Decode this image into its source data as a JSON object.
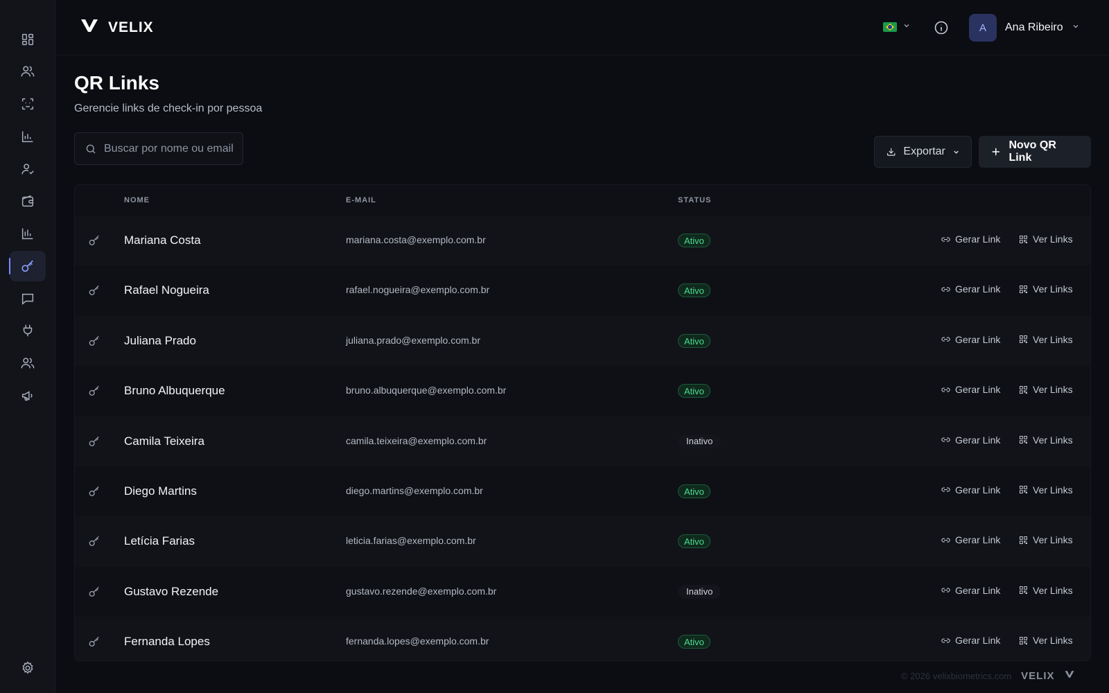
{
  "brand": {
    "name": "VELIX"
  },
  "topbar": {
    "language": "pt-BR",
    "user": {
      "initial": "A",
      "name": "Ana Ribeiro"
    }
  },
  "sidebar": {
    "items": [
      {
        "icon": "dashboard-icon"
      },
      {
        "icon": "users-icon"
      },
      {
        "icon": "face-scan-icon"
      },
      {
        "icon": "bar-chart-icon"
      },
      {
        "icon": "user-check-icon"
      },
      {
        "icon": "wallet-icon"
      },
      {
        "icon": "reports-chart-icon"
      },
      {
        "icon": "key-icon",
        "active": true
      },
      {
        "icon": "message-icon"
      },
      {
        "icon": "plug-icon"
      },
      {
        "icon": "team-icon"
      },
      {
        "icon": "megaphone-icon"
      }
    ],
    "settings_icon": "gear-icon"
  },
  "page": {
    "title": "QR Links",
    "subtitle": "Gerencie links de check-in por pessoa"
  },
  "search": {
    "placeholder": "Buscar por nome ou email",
    "value": ""
  },
  "toolbar": {
    "export_label": "Exportar",
    "new_label": "Novo QR Link"
  },
  "table": {
    "columns": [
      "NOME",
      "E-MAIL",
      "STATUS"
    ],
    "actions": {
      "generate": "Gerar Link",
      "view": "Ver Links"
    },
    "rows": [
      {
        "name": "Mariana Costa",
        "email": "mariana.costa@exemplo.com.br",
        "status": "Ativo"
      },
      {
        "name": "Rafael Nogueira",
        "email": "rafael.nogueira@exemplo.com.br",
        "status": "Ativo"
      },
      {
        "name": "Juliana Prado",
        "email": "juliana.prado@exemplo.com.br",
        "status": "Ativo"
      },
      {
        "name": "Bruno Albuquerque",
        "email": "bruno.albuquerque@exemplo.com.br",
        "status": "Ativo"
      },
      {
        "name": "Camila Teixeira",
        "email": "camila.teixeira@exemplo.com.br",
        "status": "Inativo"
      },
      {
        "name": "Diego Martins",
        "email": "diego.martins@exemplo.com.br",
        "status": "Ativo"
      },
      {
        "name": "Letícia Farias",
        "email": "leticia.farias@exemplo.com.br",
        "status": "Ativo"
      },
      {
        "name": "Gustavo Rezende",
        "email": "gustavo.rezende@exemplo.com.br",
        "status": "Inativo"
      },
      {
        "name": "Fernanda Lopes",
        "email": "fernanda.lopes@exemplo.com.br",
        "status": "Ativo"
      }
    ]
  },
  "footer": {
    "copyright": "© 2026 velixbiometrics.com",
    "logo": "VELIX"
  },
  "colors": {
    "accent": "#8c9cff",
    "active_status": "#4ddb93",
    "background": "#0b0d12"
  }
}
